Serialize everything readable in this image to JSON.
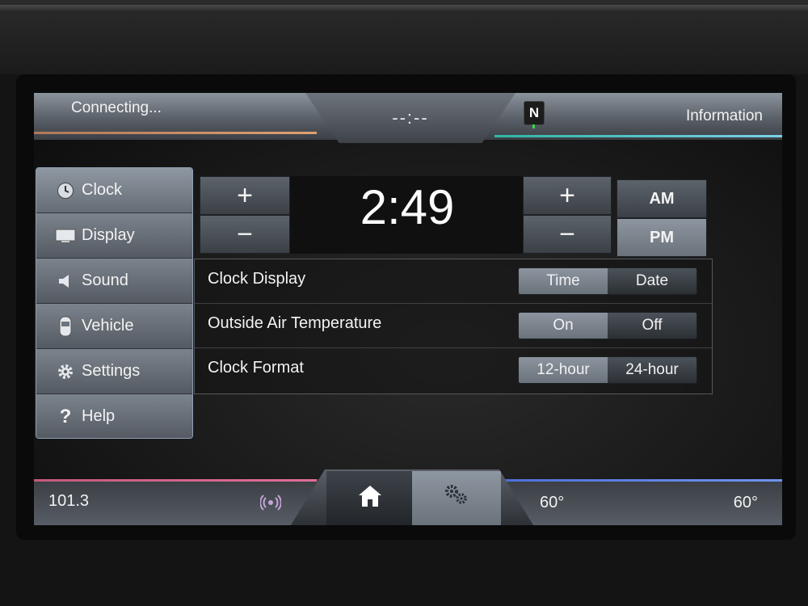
{
  "topbar": {
    "status": "Connecting...",
    "time_placeholder": "--:--",
    "compass": "N",
    "info_label": "Information"
  },
  "sidebar": {
    "items": [
      {
        "label": "Clock",
        "icon": "clock-icon"
      },
      {
        "label": "Display",
        "icon": "display-icon"
      },
      {
        "label": "Sound",
        "icon": "speaker-icon"
      },
      {
        "label": "Vehicle",
        "icon": "car-icon"
      },
      {
        "label": "Settings",
        "icon": "gear-icon"
      },
      {
        "label": "Help",
        "icon": "question-icon"
      }
    ],
    "active": "Clock"
  },
  "clock": {
    "time": "2:49",
    "plus": "+",
    "minus": "−",
    "am": "AM",
    "pm": "PM",
    "selected_period": "PM"
  },
  "settings": {
    "clock_display": {
      "label": "Clock Display",
      "options": [
        "Time",
        "Date"
      ],
      "selected": "Time"
    },
    "outside_temp": {
      "label": "Outside Air Temperature",
      "options": [
        "On",
        "Off"
      ],
      "selected": "On"
    },
    "clock_format": {
      "label": "Clock Format",
      "options": [
        "12-hour",
        "24-hour"
      ],
      "selected": "12-hour"
    }
  },
  "bottombar": {
    "radio": "101.3",
    "temp_left": "60°",
    "temp_right": "60°"
  },
  "colors": {
    "accent_orange": "#e0a070",
    "accent_teal": "#2fb7a4",
    "accent_pink": "#e06e9a",
    "accent_blue": "#6f95f0",
    "compass_green": "#39d34a"
  }
}
